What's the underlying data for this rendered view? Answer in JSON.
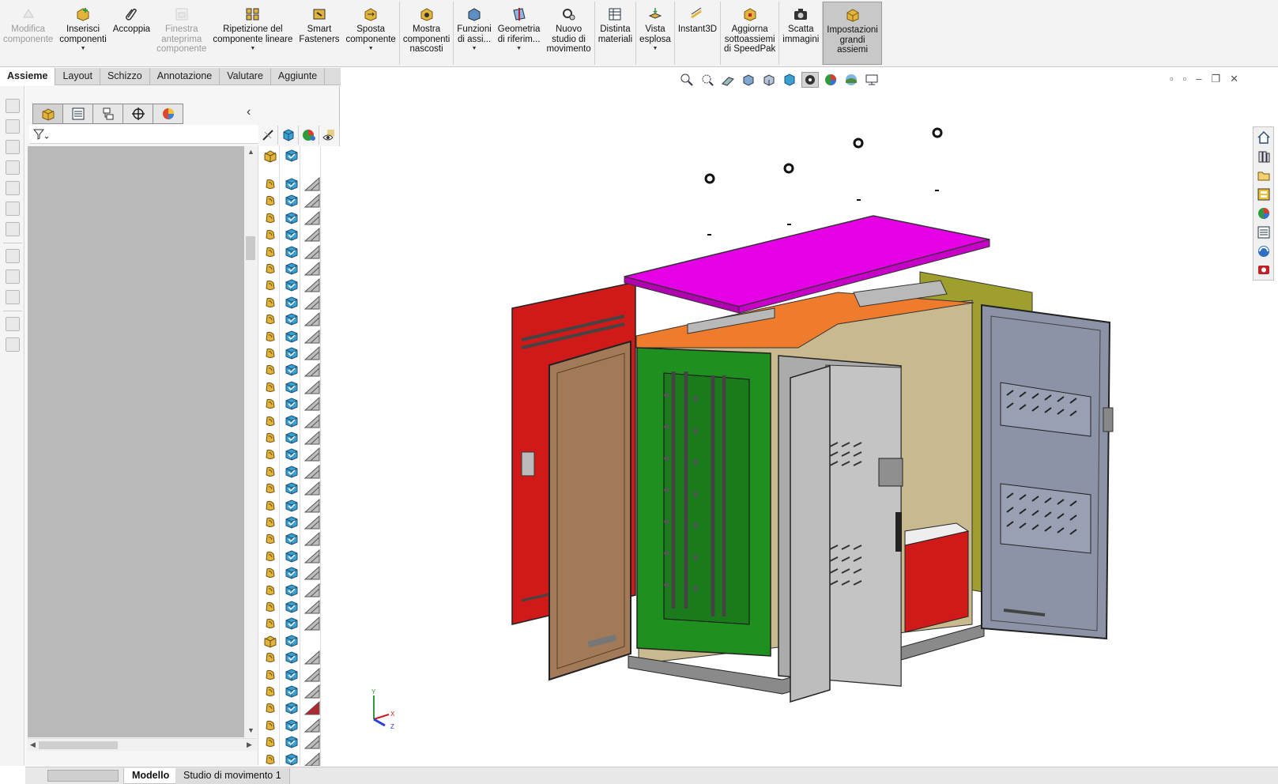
{
  "ribbon": {
    "items": [
      {
        "label": "Modifica\ncomponente",
        "icon": "edit-component-icon",
        "disabled": true,
        "dropdown": false
      },
      {
        "label": "Inserisci\ncomponenti",
        "icon": "insert-components-icon",
        "disabled": false,
        "dropdown": true
      },
      {
        "label": "Accoppia",
        "icon": "mate-paperclip-icon",
        "disabled": false,
        "dropdown": false
      },
      {
        "label": "Finestra\nanteprima\ncomponente",
        "icon": "preview-window-icon",
        "disabled": true,
        "dropdown": false
      },
      {
        "label": "Ripetizione del\ncomponente lineare",
        "icon": "linear-pattern-icon",
        "disabled": false,
        "dropdown": true
      },
      {
        "label": "Smart\nFasteners",
        "icon": "smart-fasteners-icon",
        "disabled": false,
        "dropdown": false
      },
      {
        "label": "Sposta\ncomponente",
        "icon": "move-component-icon",
        "disabled": false,
        "dropdown": true
      },
      {
        "label": "Mostra\ncomponenti\nnascosti",
        "icon": "show-hidden-icon",
        "disabled": false,
        "dropdown": false
      },
      {
        "label": "Funzioni\ndi assi...",
        "icon": "assembly-features-icon",
        "disabled": false,
        "dropdown": true
      },
      {
        "label": "Geometria\ndi riferim...",
        "icon": "reference-geometry-icon",
        "disabled": false,
        "dropdown": true
      },
      {
        "label": "Nuovo\nstudio di\nmovimento",
        "icon": "motion-study-icon",
        "disabled": false,
        "dropdown": false
      },
      {
        "label": "Distinta\nmateriali",
        "icon": "bill-of-materials-icon",
        "disabled": false,
        "dropdown": false
      },
      {
        "label": "Vista\nesplosa",
        "icon": "exploded-view-icon",
        "disabled": false,
        "dropdown": true
      },
      {
        "label": "Instant3D",
        "icon": "instant3d-icon",
        "disabled": false,
        "dropdown": false
      },
      {
        "label": "Aggiorna\nsottoassiemi\ndi SpeedPak",
        "icon": "speedpak-icon",
        "disabled": false,
        "dropdown": false
      },
      {
        "label": "Scatta\nimmagini",
        "icon": "camera-icon",
        "disabled": false,
        "dropdown": false
      },
      {
        "label": "Impostazioni\ngrandi\nassiemi",
        "icon": "large-assembly-icon",
        "disabled": false,
        "dropdown": false,
        "active": true
      }
    ]
  },
  "tabs": [
    "Assieme",
    "Layout",
    "Schizzo",
    "Annotazione",
    "Valutare",
    "Aggiunte"
  ],
  "bottom_tabs": {
    "model": "Modello",
    "motion": "Studio di movimento 1"
  },
  "colors": {
    "ribbon_bg": "#f3f3f3",
    "tree_bg": "#b9b9b9",
    "part_yellow": "#e2b43b",
    "part_blue": "#3aa0d2",
    "roof_magenta": "#e600e6",
    "door_red": "#d01a1a",
    "panel_green": "#1f8f1f",
    "top_orange": "#ef7b2d",
    "door_tan": "#a27a57",
    "door_grey": "#8d93a6",
    "side_olive": "#9f9f2e"
  }
}
